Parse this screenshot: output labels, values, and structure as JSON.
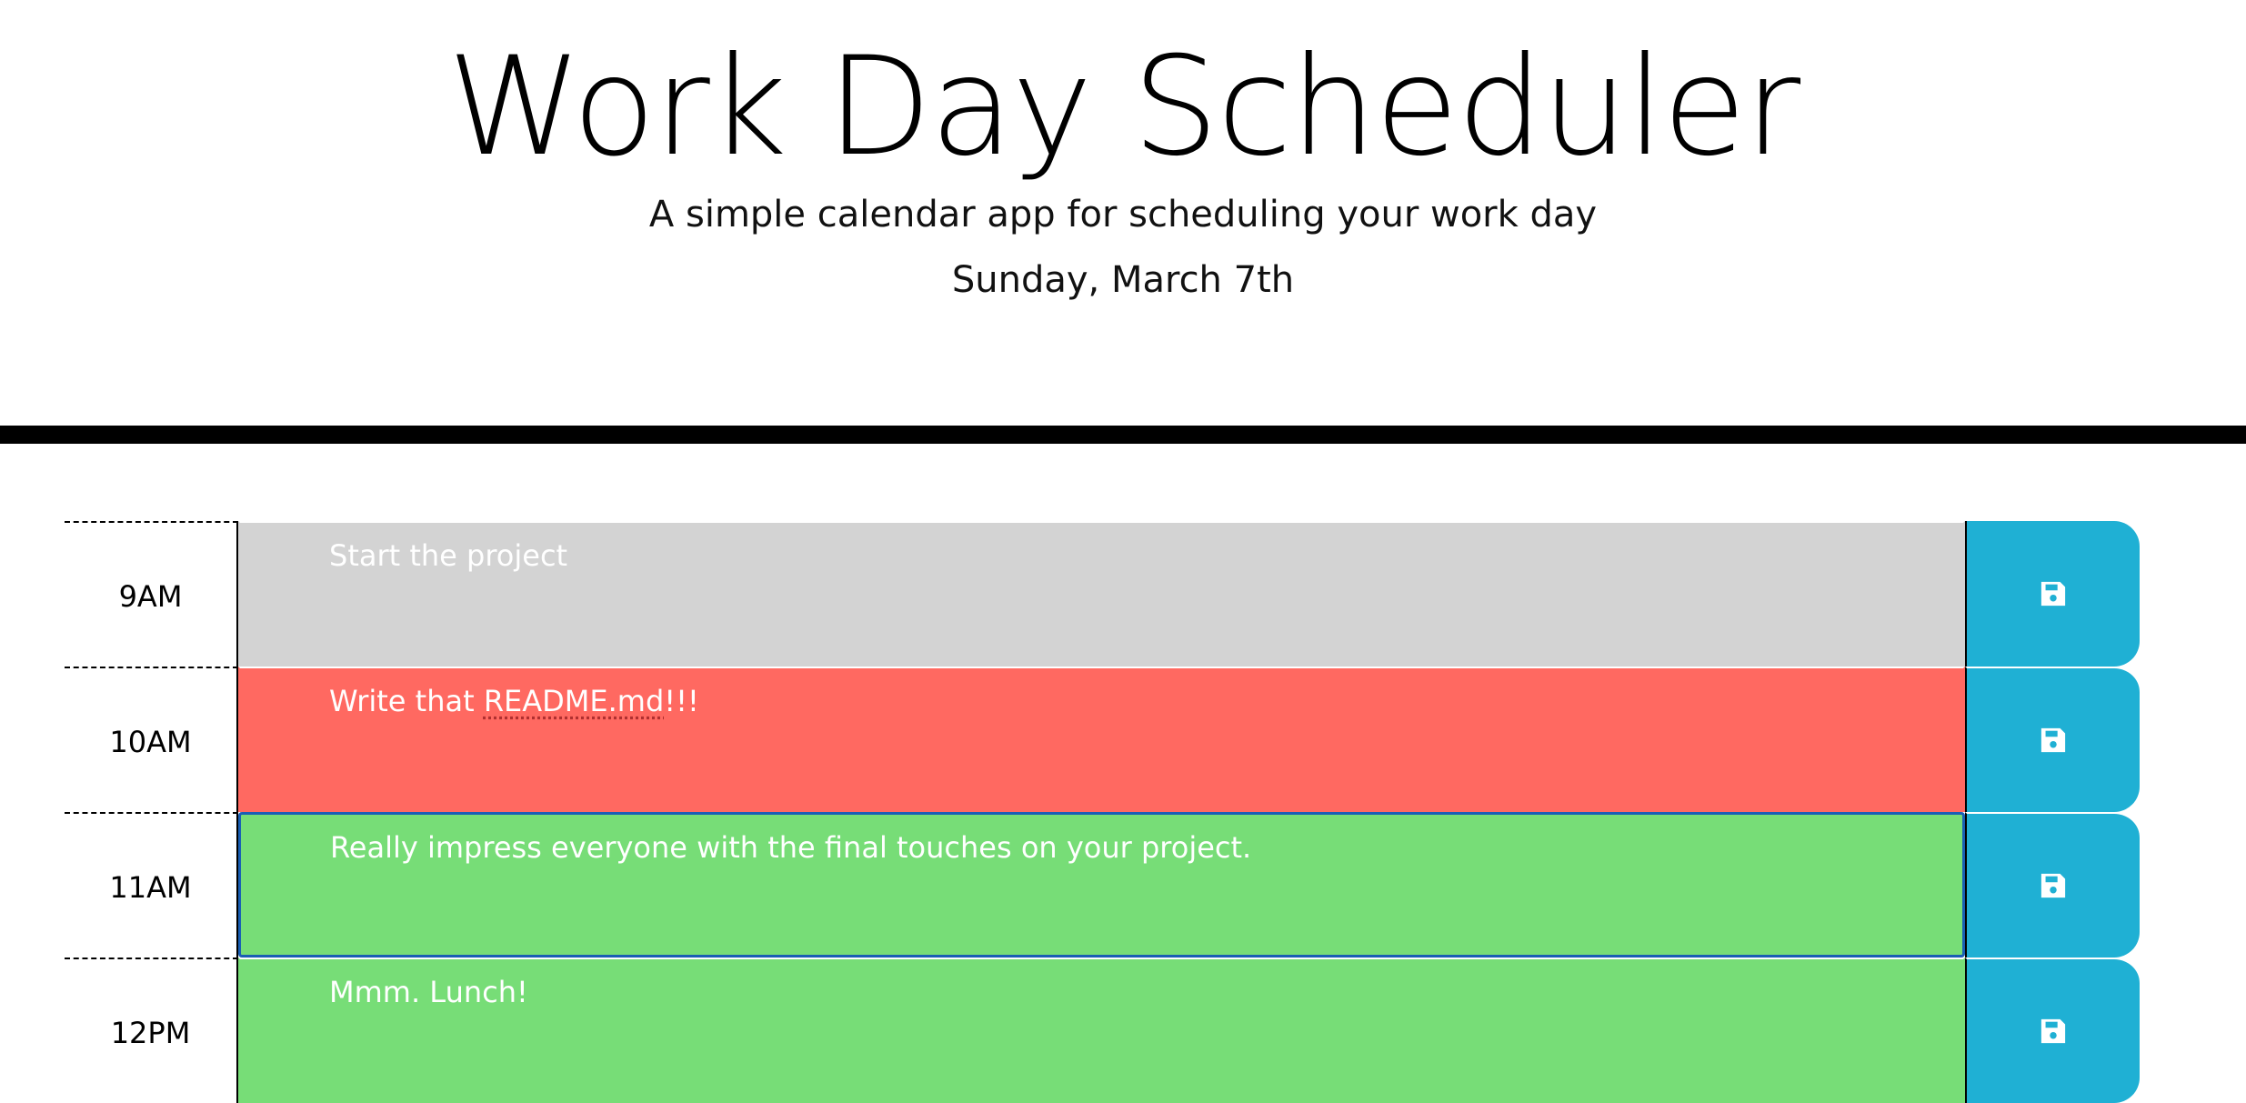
{
  "header": {
    "title": "Work Day Scheduler",
    "subtitle": "A simple calendar app for scheduling your work day",
    "current_day": "Sunday, March 7th"
  },
  "colors": {
    "past": "#d3d3d3",
    "present": "#ff6961",
    "future": "#77dd77",
    "save_button": "#1fb0d4"
  },
  "time_blocks": [
    {
      "hour": "9AM",
      "description": "Start the project",
      "status": "past",
      "save_icon": "floppy-disk-icon"
    },
    {
      "hour": "10AM",
      "description_prefix": "Write that ",
      "description_spell": "README.md",
      "description_suffix": "!!!",
      "status": "present",
      "save_icon": "floppy-disk-icon"
    },
    {
      "hour": "11AM",
      "description": "Really impress everyone with the final touches on your project.",
      "status": "future",
      "save_icon": "floppy-disk-icon"
    },
    {
      "hour": "12PM",
      "description": "Mmm. Lunch!",
      "status": "future",
      "save_icon": "floppy-disk-icon"
    }
  ]
}
